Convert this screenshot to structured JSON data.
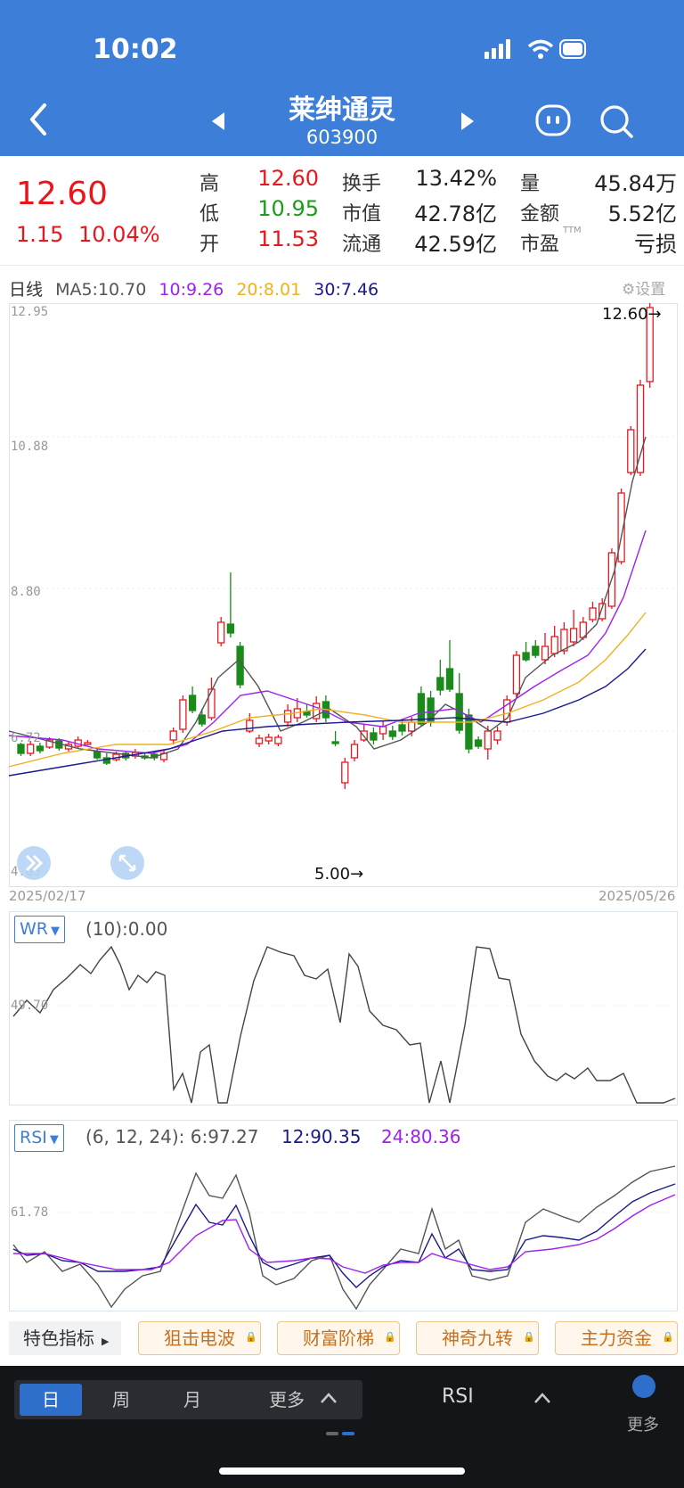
{
  "status_bar": {
    "time": "10:02"
  },
  "header": {
    "stock_name": "莱绅通灵",
    "stock_code": "603900"
  },
  "quote": {
    "price": "12.60",
    "change": "1.15",
    "change_pct": "10.04%",
    "rows": [
      {
        "l1": "高",
        "v1": "12.60",
        "l2": "换手",
        "v2": "13.42%",
        "l3": "量",
        "v3": "45.84万"
      },
      {
        "l1": "低",
        "v1": "10.95",
        "l2": "市值",
        "v2": "42.78亿",
        "l3": "金额",
        "v3": "5.52亿"
      },
      {
        "l1": "开",
        "v1": "11.53",
        "l2": "流通",
        "v2": "42.59亿",
        "l3": "市盈",
        "v3": "亏损"
      }
    ],
    "pe_suffix": "TTM"
  },
  "kline": {
    "legend": {
      "period": "日线",
      "ma5": "MA5:10.70",
      "ma10": "10:9.26",
      "ma20": "20:8.01",
      "ma30": "30:7.46"
    },
    "settings_label": "设置",
    "colors": {
      "up": "#e8171e",
      "down": "#1a8a1a",
      "ma5": "#555555",
      "ma10": "#a020f0",
      "ma20": "#f0b020",
      "ma30": "#1a1a8a"
    },
    "y_labels": [
      "12.95",
      "10.88",
      "8.80",
      "6.72",
      "4.65"
    ],
    "high_marker": "12.60→",
    "low_marker": "5.00→",
    "start_date": "2025/02/17",
    "end_date": "2025/05/26"
  },
  "wr": {
    "button": "WR",
    "params": "(10):0.00",
    "y_label": "49.70"
  },
  "rsi": {
    "button": "RSI",
    "params": "(6, 12, 24): 6:97.27",
    "rsi12": "12:90.35",
    "rsi24": "24:80.36",
    "y_label": "61.78"
  },
  "features": {
    "label": "特色指标",
    "items": [
      "狙击电波",
      "财富阶梯",
      "神奇九转",
      "主力资金"
    ]
  },
  "bottom": {
    "periods": [
      "日",
      "周",
      "月",
      "更多"
    ],
    "indicator": "RSI",
    "more": "更多"
  }
}
